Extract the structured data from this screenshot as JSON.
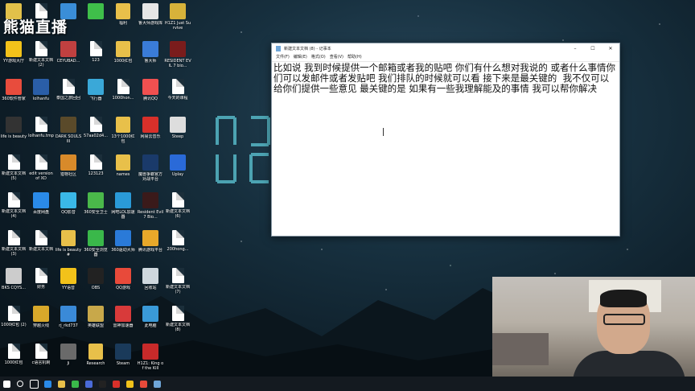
{
  "brand": "熊猫直播",
  "desktop": {
    "icons": [
      {
        "label": "",
        "kind": "app",
        "color": "#e2c14a"
      },
      {
        "label": "",
        "kind": "file",
        "color": ""
      },
      {
        "label": "",
        "kind": "app",
        "color": "#3a8ed8"
      },
      {
        "label": "",
        "kind": "app",
        "color": "#3fbf4a"
      },
      {
        "label": "福利",
        "kind": "folder",
        "color": ""
      },
      {
        "label": "鲁大师游戏库",
        "kind": "app",
        "color": "#e6e6e6"
      },
      {
        "label": "H1Z1 Just Survive",
        "kind": "app",
        "color": "#d7b23a"
      },
      {
        "label": "YY游戏大厅",
        "kind": "app",
        "color": "#f2c21a"
      },
      {
        "label": "新建文本文档 (2)",
        "kind": "file",
        "color": ""
      },
      {
        "label": "CEYUBAD...",
        "kind": "app",
        "color": "#c04040"
      },
      {
        "label": "123",
        "kind": "file",
        "color": ""
      },
      {
        "label": "1000红包",
        "kind": "folder",
        "color": ""
      },
      {
        "label": "鲁大师",
        "kind": "app",
        "color": "#3a7cd8"
      },
      {
        "label": "RESIDENT EVIL 7 bio...",
        "kind": "app",
        "color": "#7a1c1c"
      },
      {
        "label": "360软件管家",
        "kind": "app",
        "color": "#e84c3d"
      },
      {
        "label": "lolhanfu",
        "kind": "app",
        "color": "#2a5ea8"
      },
      {
        "label": "泰国之旅回回",
        "kind": "file",
        "color": ""
      },
      {
        "label": "飞行器",
        "kind": "app",
        "color": "#3aa8d8"
      },
      {
        "label": "1000hon...",
        "kind": "file",
        "color": ""
      },
      {
        "label": "腾讯QQ",
        "kind": "app",
        "color": "#f05050"
      },
      {
        "label": "今天的课程",
        "kind": "file",
        "color": ""
      },
      {
        "label": "life is beauty",
        "kind": "app",
        "color": "#333333"
      },
      {
        "label": "lolhanfu.tmp",
        "kind": "file",
        "color": ""
      },
      {
        "label": "DARK SOULS III",
        "kind": "app",
        "color": "#5a4a2a"
      },
      {
        "label": "57aa02d4...",
        "kind": "file",
        "color": ""
      },
      {
        "label": "13个1000红包",
        "kind": "folder",
        "color": ""
      },
      {
        "label": "网易云音乐",
        "kind": "app",
        "color": "#d8302a"
      },
      {
        "label": "Steep",
        "kind": "app",
        "color": "#dddddd"
      },
      {
        "label": "新建文本文档 (5)",
        "kind": "file",
        "color": ""
      },
      {
        "label": "edit version of XD",
        "kind": "file",
        "color": ""
      },
      {
        "label": "猎物社区",
        "kind": "app",
        "color": "#d88a2a"
      },
      {
        "label": "123123",
        "kind": "file",
        "color": ""
      },
      {
        "label": "names",
        "kind": "folder",
        "color": ""
      },
      {
        "label": "魔兽争霸官方对战平台",
        "kind": "app",
        "color": "#1a3a6a"
      },
      {
        "label": "Uplay",
        "kind": "app",
        "color": "#2a6ad8"
      },
      {
        "label": "新建文本文档 (4)",
        "kind": "file",
        "color": ""
      },
      {
        "label": "百度网盘",
        "kind": "app",
        "color": "#2a8ae8"
      },
      {
        "label": "QQ影音",
        "kind": "app",
        "color": "#3ab8e8"
      },
      {
        "label": "360安全卫士",
        "kind": "app",
        "color": "#4ab84a"
      },
      {
        "label": "网吧LOL加速器",
        "kind": "app",
        "color": "#2a9ad8"
      },
      {
        "label": "Resident Evil 7 Bio...",
        "kind": "app",
        "color": "#3a1a1a"
      },
      {
        "label": "新建文本文档 (6)",
        "kind": "file",
        "color": ""
      },
      {
        "label": "新建文本文档 (3)",
        "kind": "file",
        "color": ""
      },
      {
        "label": "新建文本文档",
        "kind": "file",
        "color": ""
      },
      {
        "label": "life is beauty#",
        "kind": "folder",
        "color": ""
      },
      {
        "label": "360安全浏览器",
        "kind": "app",
        "color": "#3ab84a"
      },
      {
        "label": "360驱动大师",
        "kind": "app",
        "color": "#2a7ad8"
      },
      {
        "label": "腾讯游戏平台",
        "kind": "app",
        "color": "#e8a82a"
      },
      {
        "label": "200hong...",
        "kind": "file",
        "color": ""
      },
      {
        "label": "BKS CQYS...",
        "kind": "app",
        "color": "#cccccc"
      },
      {
        "label": "财务",
        "kind": "file",
        "color": ""
      },
      {
        "label": "YY语音",
        "kind": "app",
        "color": "#f2c21a"
      },
      {
        "label": "OBS",
        "kind": "app",
        "color": "#222222"
      },
      {
        "label": "QQ游戏",
        "kind": "app",
        "color": "#e84a3a"
      },
      {
        "label": "回收站",
        "kind": "app",
        "color": "#cfd8de"
      },
      {
        "label": "新建文本文档 (7)",
        "kind": "file",
        "color": ""
      },
      {
        "label": "1000红包 (2)",
        "kind": "file",
        "color": ""
      },
      {
        "label": "穿越火线",
        "kind": "app",
        "color": "#d8a82a"
      },
      {
        "label": "rj_rkd737",
        "kind": "app",
        "color": "#3a8ad8"
      },
      {
        "label": "英雄联盟",
        "kind": "app",
        "color": "#c8a84a"
      },
      {
        "label": "雷神加速器",
        "kind": "app",
        "color": "#d83a3a"
      },
      {
        "label": "此电脑",
        "kind": "app",
        "color": "#3a9ad8"
      },
      {
        "label": "新建文本文档 (8)",
        "kind": "file",
        "color": ""
      },
      {
        "label": "1000红包",
        "kind": "file",
        "color": ""
      },
      {
        "label": "c语言机制",
        "kind": "file",
        "color": ""
      },
      {
        "label": "Ji",
        "kind": "app",
        "color": "#6a6a6a"
      },
      {
        "label": "Research",
        "kind": "folder",
        "color": ""
      },
      {
        "label": "Steam",
        "kind": "app",
        "color": "#1a3a5a"
      },
      {
        "label": "H1Z1: King of the Kill",
        "kind": "app",
        "color": "#c82a2a"
      }
    ]
  },
  "notepad": {
    "title": "新建文本文档 (8) - 记事本",
    "menu": [
      "文件(F)",
      "编辑(E)",
      "格式(O)",
      "查看(V)",
      "帮助(H)"
    ],
    "minimize": "–",
    "maximize": "☐",
    "close": "✕",
    "content": "比如说 我到时候提供一个邮箱或者我的贴吧 你们有什么想对我说的 或者什么事情你们可以发邮件或者发贴吧 我们排队的时候就可以看 接下来是最关键的  我不仅可以给你们提供一些意见 最关键的是 如果有一些我理解能及的事情 我可以帮你解决"
  },
  "taskbar": {
    "items": [
      {
        "icon": "windows-icon",
        "color": "#ffffff"
      },
      {
        "icon": "search-icon",
        "color": "#ffffff"
      },
      {
        "icon": "task-view-icon",
        "color": "#ffffff"
      },
      {
        "icon": "edge-icon",
        "color": "#2a8ae8"
      },
      {
        "icon": "file-explorer-icon",
        "color": "#e8c04a"
      },
      {
        "icon": "wechat-icon",
        "color": "#3ab84a"
      },
      {
        "icon": "app-icon",
        "color": "#4a6ad8"
      },
      {
        "icon": "obs-icon",
        "color": "#222222"
      },
      {
        "icon": "netease-icon",
        "color": "#d8302a"
      },
      {
        "icon": "yy-icon",
        "color": "#f2c21a"
      },
      {
        "icon": "tencent-icon",
        "color": "#e84a3a"
      },
      {
        "icon": "notepad-icon",
        "color": "#6fa6d8"
      }
    ]
  }
}
